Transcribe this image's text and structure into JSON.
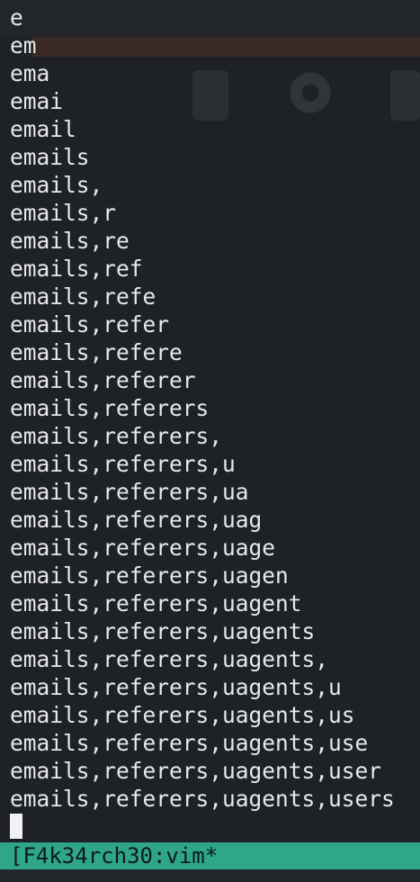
{
  "terminal": {
    "lines": [
      "e",
      "em",
      "ema",
      "emai",
      "email",
      "emails",
      "emails,",
      "emails,r",
      "emails,re",
      "emails,ref",
      "emails,refe",
      "emails,refer",
      "emails,refere",
      "emails,referer",
      "emails,referers",
      "emails,referers,",
      "emails,referers,u",
      "emails,referers,ua",
      "emails,referers,uag",
      "emails,referers,uage",
      "emails,referers,uagen",
      "emails,referers,uagent",
      "emails,referers,uagents",
      "emails,referers,uagents,",
      "emails,referers,uagents,u",
      "emails,referers,uagents,us",
      "emails,referers,uagents,use",
      "emails,referers,uagents,user",
      "emails,referers,uagents,users"
    ],
    "status_bar": "[F4k34rch30:vim*",
    "colors": {
      "background": "#1e2227",
      "text": "#e8e8e8",
      "status_bar": "#2fa58a",
      "status_text": "#0e1a17",
      "cursor": "#f2f2f2"
    }
  }
}
